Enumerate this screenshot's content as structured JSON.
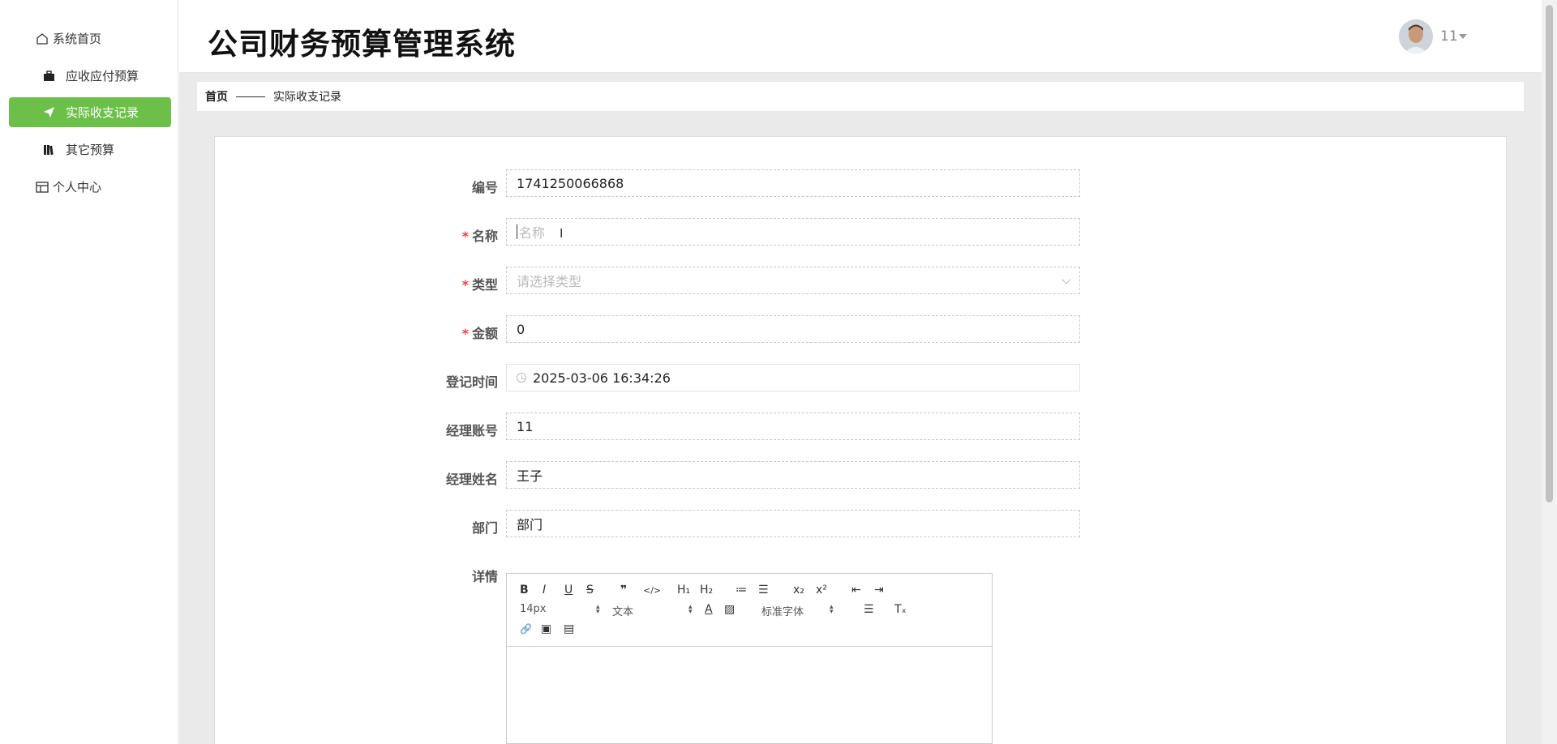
{
  "app": {
    "title": "公司财务预算管理系统"
  },
  "user": {
    "name": "11"
  },
  "sidebar": {
    "items": [
      {
        "label": "系统首页",
        "icon": "home-icon"
      },
      {
        "label": "应收应付预算",
        "icon": "briefcase-icon"
      },
      {
        "label": "实际收支记录",
        "icon": "paper-plane-icon",
        "active": true
      },
      {
        "label": "其它预算",
        "icon": "books-icon"
      },
      {
        "label": "个人中心",
        "icon": "card-icon"
      }
    ]
  },
  "breadcrumb": {
    "home": "首页",
    "current": "实际收支记录"
  },
  "form": {
    "fields": {
      "bianhao": {
        "label": "编号",
        "value": "1741250066868"
      },
      "mingcheng": {
        "label": "名称",
        "placeholder": "名称",
        "required": true
      },
      "leixing": {
        "label": "类型",
        "placeholder": "请选择类型",
        "required": true
      },
      "jine": {
        "label": "金额",
        "value": "0",
        "required": true
      },
      "dengjishijian": {
        "label": "登记时间",
        "value": "2025-03-06 16:34:26"
      },
      "jinglizhanghao": {
        "label": "经理账号",
        "value": "11"
      },
      "jinglixingming": {
        "label": "经理姓名",
        "value": "王子"
      },
      "bumen": {
        "label": "部门",
        "value": "部门"
      },
      "xiangqing": {
        "label": "详情"
      }
    },
    "required_mark": "*"
  },
  "editor": {
    "font_size": "14px",
    "text_style": "文本",
    "font_family": "标准字体",
    "buttons": {
      "bold": "B",
      "italic": "I",
      "underline": "U",
      "strike": "S",
      "quote": "❞",
      "code": "</>",
      "h1": "H₁",
      "h2": "H₂",
      "ol": "≔",
      "ul": "☰",
      "sub": "x₂",
      "sup": "x²",
      "outdent": "⇤",
      "indent": "⇥",
      "color": "A",
      "bg": "▨",
      "align": "☰",
      "clean": "Tₓ",
      "link": "🔗",
      "image": "▣",
      "video": "▤"
    }
  },
  "colors": {
    "accent": "#6cc04a",
    "required": "#e44444"
  }
}
